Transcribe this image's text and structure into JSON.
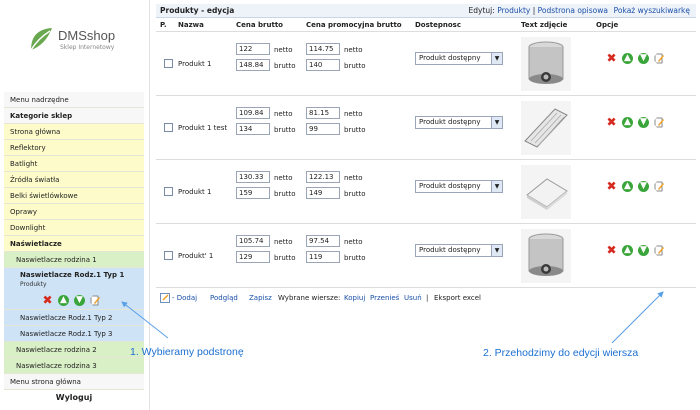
{
  "logo": {
    "brand": "DMSshop",
    "tagline": "Sklep Internetowy"
  },
  "sidebar": {
    "items": [
      {
        "label": "Menu nadrzędne",
        "style": "head"
      },
      {
        "label": "Kategorie sklep",
        "style": "bold"
      },
      {
        "label": "Strona główna",
        "style": "yellow"
      },
      {
        "label": "Reflektory",
        "style": "yellow"
      },
      {
        "label": "Batlight",
        "style": "yellow"
      },
      {
        "label": "Źródła światła",
        "style": "yellow"
      },
      {
        "label": "Belki świetlówkowe",
        "style": "yellow"
      },
      {
        "label": "Oprawy",
        "style": "yellow"
      },
      {
        "label": "Downlight",
        "style": "yellow"
      },
      {
        "label": "Naświetlacze",
        "style": "bold-y"
      },
      {
        "label": "Naswietlacze rodzina 1",
        "style": "green"
      }
    ],
    "selected": {
      "label": "Naswietlacze Rodz.1 Typ 1",
      "sub": "Produkty"
    },
    "items2": [
      {
        "label": "Naswietlacze Rodz.1 Typ 2",
        "style": "blue"
      },
      {
        "label": "Naswietlacze Rodz.1 Typ 3",
        "style": "blue"
      },
      {
        "label": "Naswietlacze rodzina 2",
        "style": "green"
      },
      {
        "label": "Naswietlacze rodzina 3",
        "style": "green"
      }
    ],
    "bottom_menu": "Menu strona główna",
    "logout": "Wyloguj"
  },
  "main": {
    "title": "Produkty - edycja",
    "edit_prefix": "Edytuj:",
    "edit_products": "Produkty",
    "edit_separator": "|",
    "edit_subpage": "Podstrona opisowa",
    "preview": "Pokaż wyszukiwarkę",
    "columns": {
      "p": "P.",
      "name": "Nazwa",
      "price": "Cena brutto",
      "promo": "Cena promocyjna brutto",
      "availability": "Dostepnosc",
      "image": "Text zdjęcie",
      "options": "Opcje"
    },
    "net_label": "netto",
    "gross_label": "brutto",
    "rows": [
      {
        "name": "Produkt 1",
        "price_net": "122",
        "price_gross": "148.84",
        "promo_net": "114.75",
        "promo_gross": "140",
        "availability": "Produkt dostępny",
        "image": "cylinder-lamp"
      },
      {
        "name": "Produkt 1 test",
        "price_net": "109.84",
        "price_gross": "134",
        "promo_net": "81.15",
        "promo_gross": "99",
        "availability": "Produkt dostępny",
        "image": "linear-fixture"
      },
      {
        "name": "Produkt 1",
        "price_net": "130.33",
        "price_gross": "159",
        "promo_net": "122.13",
        "promo_gross": "149",
        "availability": "Produkt dostępny",
        "image": "square-panel"
      },
      {
        "name": "Produkt' 1",
        "price_net": "105.74",
        "price_gross": "129",
        "promo_net": "97.54",
        "promo_gross": "119",
        "availability": "Produkt dostępny",
        "image": "cylinder-lamp"
      }
    ],
    "footer": {
      "add": "- Dodaj",
      "preview": "Podgląd",
      "save": "Zapisz",
      "selected_rows": "Wybrane wiersze:",
      "copy": "Kopiuj",
      "move": "Przenieś",
      "delete": "Usuń",
      "separator": "|",
      "export": "Eksport excel"
    }
  },
  "annotations": {
    "left": "1. Wybieramy podstronę",
    "right": "2. Przehodzimy do edycji wiersza",
    "color": "#1c6fd1"
  }
}
